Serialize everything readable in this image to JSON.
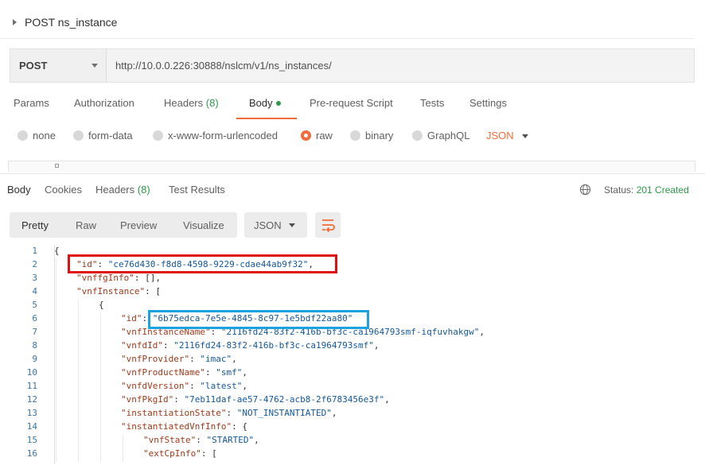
{
  "request": {
    "title": "POST ns_instance",
    "method": "POST",
    "url": "http://10.0.0.226:30888/nslcm/v1/ns_instances/"
  },
  "request_tabs": {
    "params": "Params",
    "authorization": "Authorization",
    "headers": "Headers",
    "headers_count": "(8)",
    "body": "Body",
    "pre_request": "Pre-request Script",
    "tests": "Tests",
    "settings": "Settings"
  },
  "body_types": {
    "none": "none",
    "form_data": "form-data",
    "urlencoded": "x-www-form-urlencoded",
    "raw": "raw",
    "binary": "binary",
    "graphql": "GraphQL",
    "format": "JSON",
    "selected": "raw"
  },
  "response_tabs": {
    "body": "Body",
    "cookies": "Cookies",
    "headers": "Headers",
    "headers_count": "(8)",
    "test_results": "Test Results",
    "status_label": "Status:",
    "status_value": "201 Created"
  },
  "view_modes": {
    "pretty": "Pretty",
    "raw": "Raw",
    "preview": "Preview",
    "visualize": "Visualize",
    "format": "JSON"
  },
  "icons": {
    "wrap": "wrap-lines-icon",
    "globe": "globe-icon"
  },
  "colors": {
    "accent": "#f26b3a",
    "success": "#2d9a4a",
    "highlight_red": "#e01010",
    "highlight_blue": "#1aa3e0"
  },
  "code_lines": [
    {
      "n": "1",
      "t": "{"
    },
    {
      "n": "2",
      "t": "\"id\": \"ce76d430-f8d8-4598-9229-cdae44ab9f32\","
    },
    {
      "n": "3",
      "t": "\"vnffgInfo\": [],"
    },
    {
      "n": "4",
      "t": "\"vnfInstance\": ["
    },
    {
      "n": "5",
      "t": "{"
    },
    {
      "n": "6",
      "t": "\"id\": \"6b75edca-7e5e-4845-8c97-1e5bdf22aa80\""
    },
    {
      "n": "7",
      "t": "\"vnfInstanceName\": \"2116fd24-83f2-416b-bf3c-ca1964793smf-iqfuvhakgw\","
    },
    {
      "n": "8",
      "t": "\"vnfdId\": \"2116fd24-83f2-416b-bf3c-ca1964793smf\","
    },
    {
      "n": "9",
      "t": "\"vnfProvider\": \"imac\","
    },
    {
      "n": "10",
      "t": "\"vnfProductName\": \"smf\","
    },
    {
      "n": "11",
      "t": "\"vnfdVersion\": \"latest\","
    },
    {
      "n": "12",
      "t": "\"vnfPkgId\": \"7eb11daf-ae57-4762-acb8-2f6783456e3f\","
    },
    {
      "n": "13",
      "t": "\"instantiationState\": \"NOT_INSTANTIATED\","
    },
    {
      "n": "14",
      "t": "\"instantiatedVnfInfo\": {"
    },
    {
      "n": "15",
      "t": "\"vnfState\": \"STARTED\","
    },
    {
      "n": "16",
      "t": "\"extCpInfo\": ["
    }
  ]
}
